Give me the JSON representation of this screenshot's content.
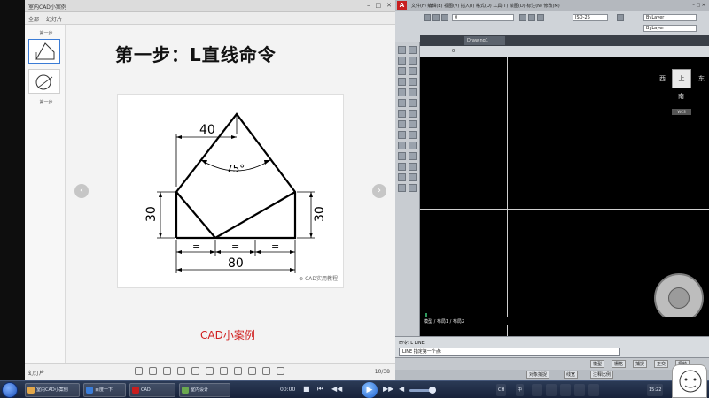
{
  "viewer": {
    "window_title": "室内CAD小案例",
    "menu": [
      "全部",
      "幻灯片"
    ],
    "thumb_label_1": "第一步",
    "thumb_label_2": "第一步",
    "slide_title": "第一步：L直线命令",
    "caption": "CAD小案例",
    "watermark": "CAD实用教程",
    "bottom_left": "幻灯片",
    "bottom_right": "10/38"
  },
  "drawing": {
    "dim_top": "40",
    "angle": "75°",
    "dim_left": "30",
    "dim_right": "30",
    "eq": "=",
    "dim_bottom": "80"
  },
  "cad": {
    "title_left": "文件(F)  编辑(E)  视图(V)  插入(I)  格式(O)  工具(T)  绘图(D)  标注(N)  修改(M)",
    "layer_field": "0",
    "dim_style": "ISO-25",
    "linetype_field": "ByLayer",
    "tab_label": "Drawing1",
    "layerbar_text": "0",
    "viewcube_top": "上",
    "vc_west": "西",
    "vc_east": "东",
    "vc_south": "南",
    "vc_wcs": "WCS",
    "model_tabs": "模型 / 布局1 / 布局2",
    "cmd_history": "命令: L LINE",
    "cmd_prompt": "LINE 指定第一个点:",
    "status_items": [
      "模型",
      "栅格",
      "捕捉",
      "正交",
      "极轴",
      "对象捕捉",
      "线宽",
      "注释比例"
    ]
  },
  "taskbar": {
    "tasks": [
      "室内CAD小案例",
      "百度一下",
      "CAD",
      "室内设计"
    ],
    "media_time": "00:00",
    "tray_items": [
      "CH",
      "中",
      "15:22"
    ]
  }
}
